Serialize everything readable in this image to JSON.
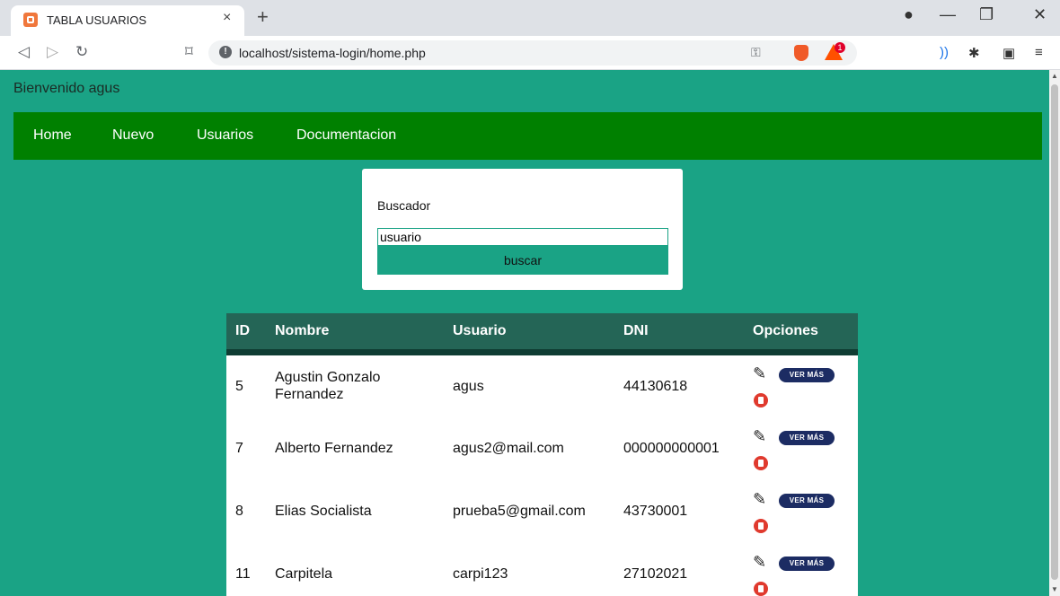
{
  "browser": {
    "tab_title": "TABLA USUARIOS",
    "tab_close": "×",
    "new_tab": "+",
    "url": "localhost/sistema-login/home.php",
    "bat_badge": "1"
  },
  "page": {
    "welcome": "Bienvenido agus",
    "nav": [
      "Home",
      "Nuevo",
      "Usuarios",
      "Documentacion"
    ],
    "search": {
      "label": "Buscador",
      "value": "usuario",
      "button": "buscar"
    },
    "table": {
      "headers": [
        "ID",
        "Nombre",
        "Usuario",
        "DNI",
        "Opciones"
      ],
      "rows": [
        {
          "id": "5",
          "nombre_line1": "Agustin Gonzalo",
          "nombre_line2": "Fernandez",
          "usuario": "agus",
          "dni": "44130618"
        },
        {
          "id": "7",
          "nombre_line1": "Alberto Fernandez",
          "nombre_line2": "",
          "usuario": "agus2@mail.com",
          "dni": "000000000001"
        },
        {
          "id": "8",
          "nombre_line1": "Elias Socialista",
          "nombre_line2": "",
          "usuario": "prueba5@gmail.com",
          "dni": "43730001"
        },
        {
          "id": "11",
          "nombre_line1": "Carpitela",
          "nombre_line2": "",
          "usuario": "carpi123",
          "dni": "27102021"
        }
      ],
      "ver_mas_label": "VER MÁS"
    }
  },
  "colors": {
    "page_bg": "#1aa385",
    "navbar_bg": "#008000",
    "table_header_bg": "#246556",
    "ver_mas_bg": "#1c2c63",
    "delete_icon": "#e03a2e"
  }
}
